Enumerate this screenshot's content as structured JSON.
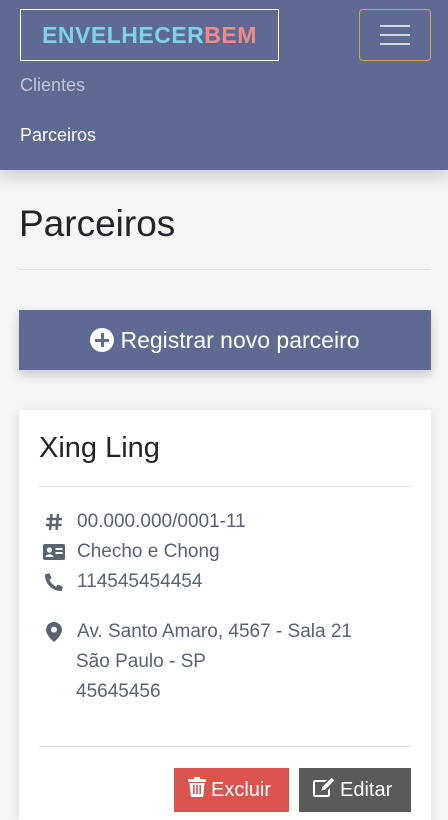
{
  "navbar": {
    "brand_part1": "ENVELHECER",
    "brand_part2": "BEM",
    "links": [
      "Clientes",
      "Parceiros"
    ]
  },
  "page": {
    "title": "Parceiros",
    "register_button_label": "Registrar novo parceiro"
  },
  "partner": {
    "name": "Xing Ling",
    "cnpj": "00.000.000/0001-11",
    "contact": "Checho e Chong",
    "phone": "114545454454",
    "address_line1": "Av. Santo Amaro, 4567 - Sala 21",
    "address_line2": "São Paulo - SP",
    "address_line3": "45645456",
    "delete_label": "Excluir",
    "edit_label": "Editar"
  },
  "colors": {
    "navbar_bg": "#5f6a93",
    "brand_primary": "#7fd3e6",
    "brand_accent": "#f08a8a",
    "danger": "#d9534f",
    "secondary": "#5a5a5a"
  },
  "icons": [
    "plus-circle-icon",
    "hash-icon",
    "id-card-icon",
    "phone-icon",
    "map-marker-icon",
    "trash-icon",
    "edit-icon"
  ]
}
